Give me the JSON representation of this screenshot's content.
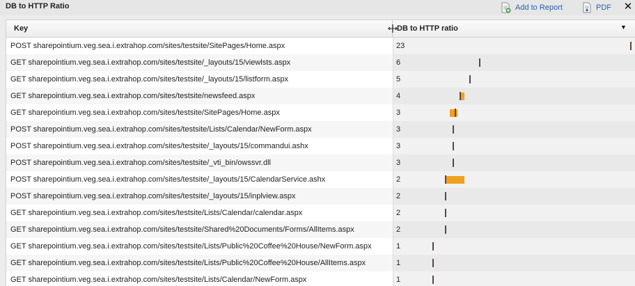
{
  "window": {
    "title": "DB to HTTP Ratio",
    "add_to_report": "Add to Report",
    "pdf": "PDF",
    "close": "✕"
  },
  "table": {
    "columns": [
      "Key",
      "DB to HTTP ratio"
    ],
    "sort_indicator": "▼",
    "rows": [
      {
        "key": "POST sharepointium.veg.sea.i.extrahop.com/sites/testsite/SitePages/Home.aspx",
        "value": "23",
        "median": 23,
        "box": null
      },
      {
        "key": "GET sharepointium.veg.sea.i.extrahop.com/sites/testsite/_layouts/15/viewlsts.aspx",
        "value": "6",
        "median": 6,
        "box": null
      },
      {
        "key": "GET sharepointium.veg.sea.i.extrahop.com/sites/testsite/_layouts/15/listform.aspx",
        "value": "5",
        "median": 5,
        "box": null
      },
      {
        "key": "GET sharepointium.veg.sea.i.extrahop.com/sites/testsite/newsfeed.aspx",
        "value": "4",
        "median": 4,
        "box": [
          4,
          4.5
        ]
      },
      {
        "key": "GET sharepointium.veg.sea.i.extrahop.com/sites/testsite/SitePages/Home.aspx",
        "value": "3",
        "median": 3.5,
        "box": [
          3,
          3.8
        ]
      },
      {
        "key": "POST sharepointium.veg.sea.i.extrahop.com/sites/testsite/Lists/Calendar/NewForm.aspx",
        "value": "3",
        "median": 3.3,
        "box": null
      },
      {
        "key": "POST sharepointium.veg.sea.i.extrahop.com/sites/testsite/_layouts/15/commandui.ashx",
        "value": "3",
        "median": 3.3,
        "box": null
      },
      {
        "key": "POST sharepointium.veg.sea.i.extrahop.com/sites/testsite/_vti_bin/owssvr.dll",
        "value": "3",
        "median": 3.3,
        "box": null
      },
      {
        "key": "POST sharepointium.veg.sea.i.extrahop.com/sites/testsite/_layouts/15/CalendarService.ashx",
        "value": "2",
        "median": 2.5,
        "box": [
          2.5,
          4.5
        ]
      },
      {
        "key": "POST sharepointium.veg.sea.i.extrahop.com/sites/testsite/_layouts/15/inplview.aspx",
        "value": "2",
        "median": 2.5,
        "box": null
      },
      {
        "key": "GET sharepointium.veg.sea.i.extrahop.com/sites/testsite/Lists/Calendar/calendar.aspx",
        "value": "2",
        "median": 2.5,
        "box": null
      },
      {
        "key": "GET sharepointium.veg.sea.i.extrahop.com/sites/testsite/Shared%20Documents/Forms/AllItems.aspx",
        "value": "2",
        "median": 2.5,
        "box": null
      },
      {
        "key": "GET sharepointium.veg.sea.i.extrahop.com/sites/testsite/Lists/Public%20Coffee%20House/NewForm.aspx",
        "value": "1",
        "median": 1.3,
        "box": null
      },
      {
        "key": "GET sharepointium.veg.sea.i.extrahop.com/sites/testsite/Lists/Public%20Coffee%20House/AllItems.aspx",
        "value": "1",
        "median": 1.3,
        "box": null
      },
      {
        "key": "GET sharepointium.veg.sea.i.extrahop.com/sites/testsite/Lists/Calendar/NewForm.aspx",
        "value": "1",
        "median": 1.3,
        "box": null
      }
    ]
  },
  "icons": {
    "add_to_report": "add-report-icon",
    "pdf": "pdf-icon",
    "close": "close-icon",
    "resize": "column-resize-icon"
  },
  "colors": {
    "box": "#f0a020",
    "median": "#5a4a3a",
    "link": "#2a5fb0"
  }
}
